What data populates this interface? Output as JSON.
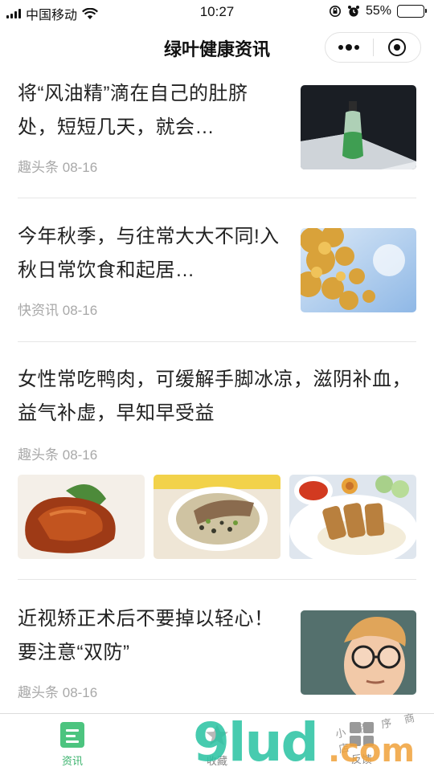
{
  "status_bar": {
    "carrier": "中国移动",
    "time": "10:27",
    "battery": "55%",
    "battery_level": 0.55
  },
  "nav": {
    "title": "绿叶健康资讯",
    "more_icon": "more-dots-icon",
    "close_icon": "target-icon"
  },
  "articles": [
    {
      "title": "将“风油精”滴在自己的肚脐处，短短几天，就会…",
      "source": "趣头条",
      "date": "08-16"
    },
    {
      "title": "今年秋季，与往常大大不同!入秋日常饮食和起居…",
      "source": "快资讯",
      "date": "08-16"
    },
    {
      "title": "女性常吃鸭肉，可缓解手脚冰凉，滋阴补血，益气补虚，早知早受益",
      "source": "趣头条",
      "date": "08-16"
    },
    {
      "title": "近视矫正术后不要掉以轻心！要注意“双防”",
      "source": "趣头条",
      "date": "08-16"
    }
  ],
  "tabs": [
    {
      "label": "资讯",
      "icon": "news-icon",
      "active": true
    },
    {
      "label": "收藏",
      "icon": "star-icon",
      "active": false
    },
    {
      "label": "反馈",
      "icon": "feedback-icon",
      "active": false
    }
  ],
  "watermark": {
    "main": "9lud",
    "suffix": ".com",
    "small": "小 程 序 商 店"
  },
  "colors": {
    "accent": "#3bb36d",
    "meta_text": "#a8a8a8"
  }
}
